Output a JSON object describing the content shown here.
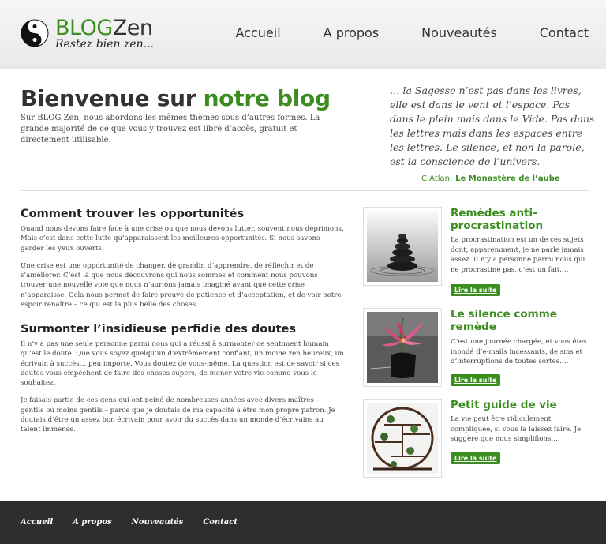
{
  "header": {
    "logo_title_part1": "BLOG",
    "logo_title_part2": "Zen",
    "logo_tagline": "Restez bien zen...",
    "nav": [
      "Accueil",
      "A propos",
      "Nouveautés",
      "Contact"
    ]
  },
  "intro": {
    "title_part1": "Bienvenue sur ",
    "title_part2": "notre blog",
    "text": "Sur BLOG Zen, nous abordons les mêmes thèmes sous d’autres formes. La grande majorité de ce que vous y trouvez est libre d’accès, gratuit et directement utilisable."
  },
  "quote": {
    "text": "… la Sagesse n’est pas dans les livres, elle est dans le vent et l’espace. Pas dans le plein mais dans le Vide. Pas dans les lettres mais dans les espaces entre les lettres. Le silence, et non la parole, est la conscience de l’univers.",
    "author": "C.Atlan,",
    "work": "Le Monastère de l’aube"
  },
  "articles": [
    {
      "title": "Comment trouver les opportunités",
      "paragraphs": [
        "Quand nous devons faire face à une crise ou que nous devons lutter, souvent nous déprimons. Mais c’est dans cette lutte qu’apparaissent les meilleures opportunités. Si nous savons garder les yeux ouverts.",
        "Une crise est une opportunité de changer, de grandir, d’apprendre, de réfléchir et de s’améliorer. C’est là que nous découvrons qui nous sommes et comment nous pouvons trouver une nouvelle voie que nous n’aurions jamais imaginé avant que cette crise n’apparaisse. Cela nous permet de faire preuve de patience et d’acceptation, et de voir notre espoir renaître – ce qui est la plus belle des choses."
      ]
    },
    {
      "title": "Surmonter l’insidieuse perfidie des doutes",
      "paragraphs": [
        "Il n’y a pas une seule personne parmi nous qui a réussi à surmonter ce sentiment humain qu’est le doute. Que vous soyez quelqu’un d’extrêmement confiant, un moine zen heureux, un écrivain à succès… peu importe. Vous doutez de vous-même. La question est de savoir si ces doutes vous empêchent de faire des choses supers, de mener votre vie comme vous le souhaitez.",
        "Je faisais partie de ces gens qui ont peiné de nombreuses années avec divers maîtres – gentils ou moins gentils – parce que je doutais de ma capacité à être mon propre patron. Je doutais d’être un assez bon écrivain pour avoir du succès dans un monde d’écrivains au talent immense."
      ]
    }
  ],
  "posts": [
    {
      "title": "Remèdes anti-procrastination",
      "text": "La procrastination est un de ces sujets dont, apparemment, je ne parle jamais assez. Il n’y a personne parmi nous qui ne procrastine pas, c’est un fait….",
      "button": "Lire la suite",
      "image": "stacked-stones-image"
    },
    {
      "title": "Le silence comme remède",
      "text": "C’est une journée chargée, et vous êtes inondé d’e-mails incessants, de sms et d’interruptions de toutes sortes….",
      "button": "Lire la suite",
      "image": "lily-flower-image"
    },
    {
      "title": "Petit guide de vie",
      "text": "La vie peut être ridiculement compliquée, si vous la laissez faire. Je suggère que nous simplifions….",
      "button": "Lire la suite",
      "image": "bonsai-shelf-image"
    }
  ],
  "footer": {
    "nav": [
      "Accueil",
      "A propos",
      "Nouveautés",
      "Contact"
    ]
  },
  "colors": {
    "accent": "#3b8d1f",
    "footer_bg": "#2e2e2e",
    "text": "#333333"
  }
}
